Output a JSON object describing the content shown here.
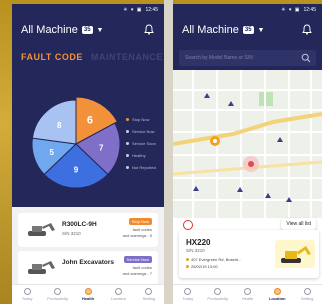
{
  "status_bar": {
    "time": "12:45",
    "icons": "✳ ▾ ▣"
  },
  "phone1": {
    "header": {
      "title": "All Machine",
      "count": "35"
    },
    "tabs": {
      "fault_code": "FAULT CODE",
      "maintenance": "MAINTENANCE"
    },
    "chart_data": {
      "type": "pie",
      "values": [
        6,
        7,
        9,
        5,
        8
      ],
      "labels": [
        "6",
        "7",
        "9",
        "5",
        "8"
      ],
      "colors": [
        "#f2913a",
        "#7f6fc8",
        "#3e6fe0",
        "#6fa8ee",
        "#a8c2f2"
      ],
      "legend": [
        "Stop Now",
        "Service Now",
        "Service Soon",
        "Healthy",
        "Not Reported"
      ],
      "legend_colors": [
        "#f2913a",
        "#c8cbe4",
        "#c8cbe4",
        "#c8cbe4",
        "#c8cbe4"
      ]
    },
    "machines": [
      {
        "name": "R300LC-9H",
        "sn": "S/N 3210",
        "badge": "Stop Now",
        "badge_color": "#f08a2e",
        "codes_line1": "fault codes",
        "codes_line2": "and warnings : 5"
      },
      {
        "name": "John Excavators",
        "sn": "",
        "badge": "Service Now",
        "badge_color": "#7b6fc6",
        "codes_line1": "fault codes",
        "codes_line2": "and warnings : 7"
      }
    ],
    "nav": [
      {
        "label": "Today",
        "icon": "calendar-icon"
      },
      {
        "label": "Productivity",
        "icon": "productivity-icon"
      },
      {
        "label": "Health",
        "icon": "health-icon"
      },
      {
        "label": "Location",
        "icon": "location-icon"
      },
      {
        "label": "Setting",
        "icon": "gear-icon"
      }
    ],
    "nav_active": 2
  },
  "phone2": {
    "header": {
      "title": "All Machine",
      "count": "35"
    },
    "search": {
      "placeholder": "Search by Model Name or S/N"
    },
    "view_all_label": "View all list",
    "detail": {
      "name": "HX220",
      "sn": "S/N 3210",
      "address": "407 Evergreen Rd, Boseld...",
      "date": "25/02/19 13:00"
    },
    "nav": [
      {
        "label": "Today",
        "icon": "calendar-icon"
      },
      {
        "label": "Productivity",
        "icon": "productivity-icon"
      },
      {
        "label": "Health",
        "icon": "health-icon"
      },
      {
        "label": "Location",
        "icon": "location-icon"
      },
      {
        "label": "Setting",
        "icon": "gear-icon"
      }
    ],
    "nav_active": 3
  }
}
